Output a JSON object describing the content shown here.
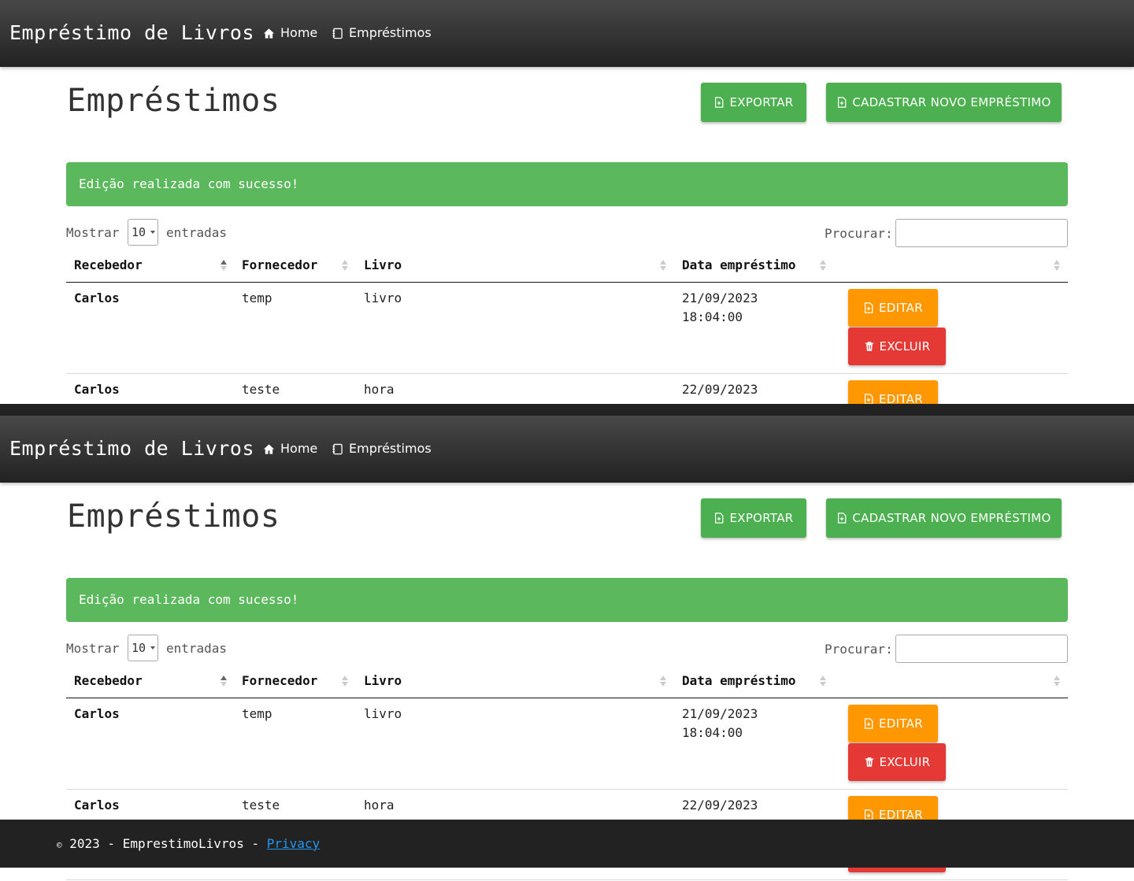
{
  "navbar": {
    "brand": "Empréstimo de Livros",
    "home": "Home",
    "loans": "Empréstimos"
  },
  "page": {
    "title": "Empréstimos",
    "export_label": "EXPORTAR",
    "new_label": "CADASTRAR NOVO EMPRÉSTIMO",
    "alert": "Edição realizada com sucesso!"
  },
  "table_controls": {
    "show_label": "Mostrar",
    "page_size": "10",
    "entries_label": "entradas",
    "search_label": "Procurar:",
    "search_value": ""
  },
  "table": {
    "columns": [
      "Recebedor",
      "Fornecedor",
      "Livro",
      "Data empréstimo",
      ""
    ],
    "rows": [
      {
        "recebedor": "Carlos",
        "fornecedor": "temp",
        "livro": "livro",
        "data_line1": "21/09/2023",
        "data_line2": "18:04:00",
        "edit_label": "EDITAR",
        "delete_label": "EXCLUIR"
      },
      {
        "recebedor": "Carlos",
        "fornecedor": "teste",
        "livro": "hora",
        "data_line1": "22/09/2023",
        "edit_label": "EDITAR"
      }
    ]
  },
  "footer": {
    "copyright_symbol": "©",
    "text": "2023 - EmprestimoLivros - ",
    "privacy": "Privacy"
  },
  "colors": {
    "navbar": "#333333",
    "success": "#4caf50",
    "alert": "#5cb85c",
    "edit": "#ff9800",
    "delete": "#e53935",
    "footer": "#222222",
    "link": "#2196f3"
  },
  "icons": {
    "home": "home-icon",
    "loans": "notebook-icon",
    "export": "file-plus-icon",
    "new": "file-plus-icon",
    "edit": "file-plus-icon",
    "delete": "trash-icon"
  }
}
